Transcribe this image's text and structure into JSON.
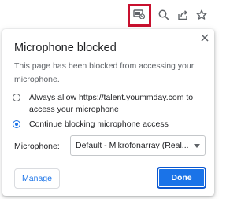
{
  "toolbar": {
    "icons": [
      "camera-blocked-icon",
      "search-icon",
      "share-icon",
      "star-icon"
    ]
  },
  "dialog": {
    "title": "Microphone blocked",
    "description": "This page has been blocked from accessing your microphone.",
    "options": [
      {
        "label": "Always allow https://talent.yoummday.com to access your microphone",
        "selected": false
      },
      {
        "label": "Continue blocking microphone access",
        "selected": true
      }
    ],
    "microphone_label": "Microphone:",
    "microphone_value": "Default - Mikrofonarray (Real...",
    "manage_label": "Manage",
    "done_label": "Done"
  },
  "colors": {
    "accent": "#1a73e8",
    "highlight_border": "#c8102e",
    "text": "#202124",
    "secondary_text": "#5f6368"
  }
}
